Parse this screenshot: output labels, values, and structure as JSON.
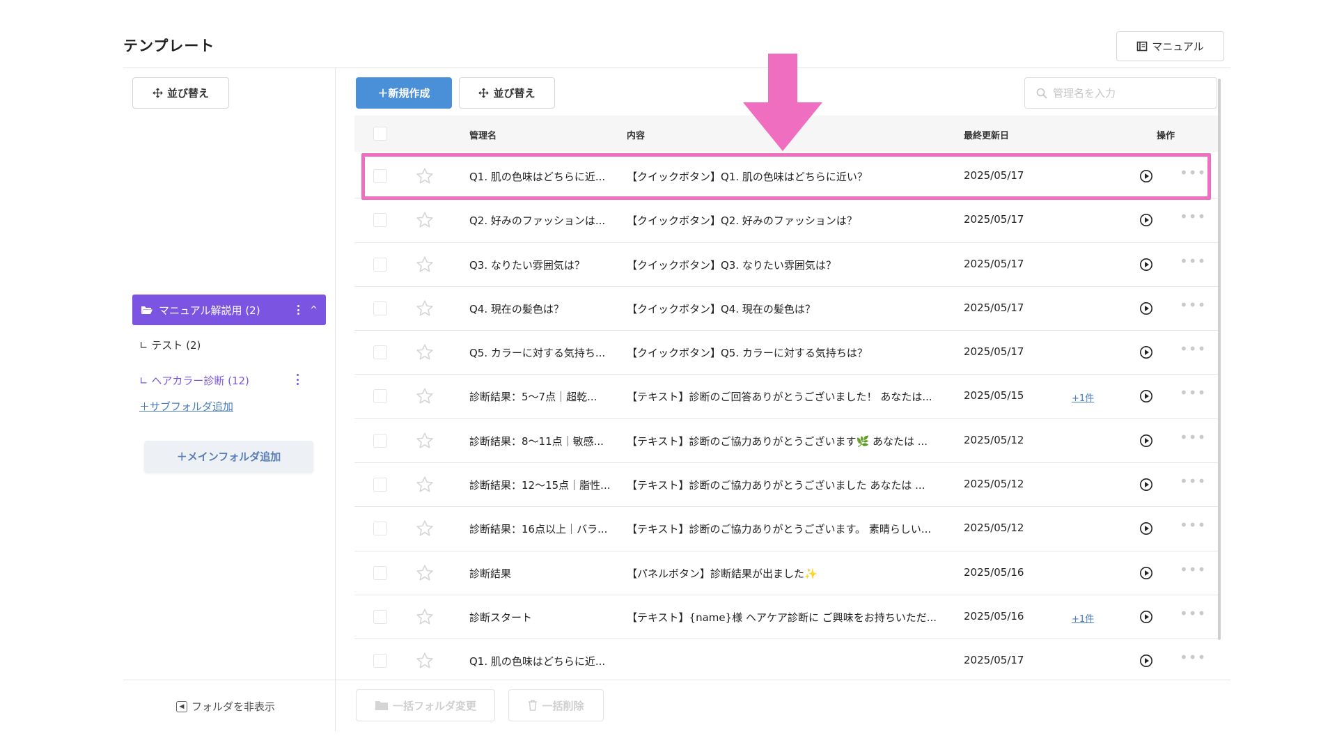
{
  "page": {
    "title": "テンプレート"
  },
  "header": {
    "manual_label": "マニュアル"
  },
  "sidebar": {
    "sort_label": "並び替え",
    "main_folder": {
      "label": "マニュアル解説用 (2)",
      "chevron": "^"
    },
    "subfolders": [
      {
        "label": "∟ テスト (2)"
      },
      {
        "label": "∟ ヘアカラー診断 (12)"
      }
    ],
    "add_subfolder_label": "＋サブフォルダ追加",
    "add_main_folder_label": "＋メインフォルダ追加",
    "hide_folder_label": "フォルダを非表示"
  },
  "toolbar": {
    "new_label": "＋新規作成",
    "sort_label": "並び替え",
    "search_placeholder": "管理名を入力"
  },
  "table": {
    "headers": {
      "name": "管理名",
      "content": "内容",
      "updated": "最終更新日",
      "actions": "操作"
    },
    "rows": [
      {
        "name": "Q1. 肌の色味はどちらに近...",
        "content": "【クイックボタン】Q1. 肌の色味はどちらに近い？",
        "date": "2025/05/17",
        "extra": ""
      },
      {
        "name": "Q2. 好みのファッションは...",
        "content": "【クイックボタン】Q2. 好みのファッションは？",
        "date": "2025/05/17",
        "extra": ""
      },
      {
        "name": "Q3. なりたい雰囲気は？",
        "content": "【クイックボタン】Q3. なりたい雰囲気は？",
        "date": "2025/05/17",
        "extra": ""
      },
      {
        "name": "Q4. 現在の髪色は？",
        "content": "【クイックボタン】Q4. 現在の髪色は？",
        "date": "2025/05/17",
        "extra": ""
      },
      {
        "name": "Q5. カラーに対する気持ち...",
        "content": "【クイックボタン】Q5. カラーに対する気持ちは？",
        "date": "2025/05/17",
        "extra": ""
      },
      {
        "name": "診断結果：5〜7点｜超乾...",
        "content": "【テキスト】診断のご回答ありがとうございました！ あなたは...",
        "date": "2025/05/15",
        "extra": "+1件"
      },
      {
        "name": "診断結果：8〜11点｜敏感...",
        "content": "【テキスト】診断のご協力ありがとうございます🌿 あなたは ...",
        "date": "2025/05/12",
        "extra": ""
      },
      {
        "name": "診断結果：12〜15点｜脂性...",
        "content": "【テキスト】診断のご協力ありがとうございました あなたは ...",
        "date": "2025/05/12",
        "extra": ""
      },
      {
        "name": "診断結果：16点以上｜バラ...",
        "content": "【テキスト】診断のご協力ありがとうございます。 素晴らしい...",
        "date": "2025/05/12",
        "extra": ""
      },
      {
        "name": "診断結果",
        "content": "【パネルボタン】診断結果が出ました✨",
        "date": "2025/05/16",
        "extra": ""
      },
      {
        "name": "診断スタート",
        "content": "【テキスト】{name}様 ヘアケア診断に ご興味をお持ちいただ...",
        "date": "2025/05/16",
        "extra": "+1件"
      },
      {
        "name": "Q1. 肌の色味はどちらに近...",
        "content": "",
        "date": "2025/05/17",
        "extra": ""
      }
    ]
  },
  "bottom": {
    "bulk_move_label": "一括フォルダ変更",
    "bulk_delete_label": "一括削除"
  },
  "colors": {
    "primary_blue": "#4a90d9",
    "folder_purple": "#7b55e2",
    "highlight_pink": "#f06ec0"
  },
  "icons": [
    "book-icon",
    "move-icon",
    "folder-open-icon",
    "search-icon",
    "star-icon",
    "play-circle-icon",
    "more-icon",
    "arrow-left-box-icon",
    "folder-icon",
    "trash-icon"
  ]
}
